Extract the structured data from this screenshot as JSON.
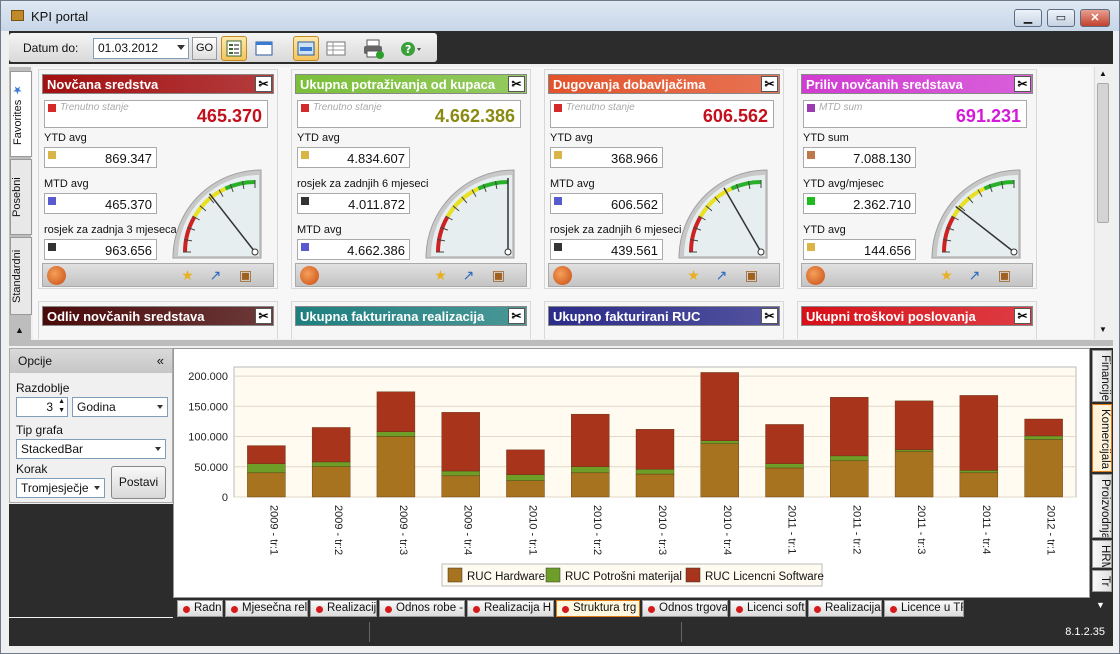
{
  "window": {
    "title": "KPI portal",
    "controls": [
      "minimize",
      "maximize",
      "close"
    ]
  },
  "toolbar": {
    "date_label": "Datum do:",
    "date_value": "01.03.2012",
    "go_label": "GO"
  },
  "side_tabs": [
    "Favorites",
    "Posebni",
    "Standardni"
  ],
  "cards_row1": [
    {
      "title": "Novčana sredstva",
      "head_color": "#a30f10",
      "main_square_color": "#d42a2a",
      "main_label": "Trenutno stanje",
      "main_value": "465.370",
      "main_value_color": "#c4101c",
      "rows": [
        {
          "label": "YTD avg",
          "value": "869.347",
          "color": "#d9b548"
        },
        {
          "label": "MTD avg",
          "value": "465.370",
          "color": "#5a5ad0"
        },
        {
          "label": "rosjek za zadnja 3 mjeseca",
          "value": "963.656",
          "color": "#333333"
        }
      ],
      "needle_angle": -38
    },
    {
      "title": "Ukupna potraživanja od kupaca",
      "head_color": "#7bbf3a",
      "main_square_color": "#d42a2a",
      "main_label": "Trenutno stanje",
      "main_value": "4.662.386",
      "main_value_color": "#8a8a10",
      "rows": [
        {
          "label": "YTD avg",
          "value": "4.834.607",
          "color": "#d9b548"
        },
        {
          "label": "rosjek za zadnjih 6 mjeseci",
          "value": "4.011.872",
          "color": "#333333"
        },
        {
          "label": "MTD avg",
          "value": "4.662.386",
          "color": "#5a5ad0"
        }
      ],
      "needle_angle": 0
    },
    {
      "title": "Dugovanja dobavljačima",
      "head_color": "#e3532b",
      "main_square_color": "#d42a2a",
      "main_label": "Trenutno stanje",
      "main_value": "606.562",
      "main_value_color": "#c4101c",
      "rows": [
        {
          "label": "YTD avg",
          "value": "368.966",
          "color": "#d9b548"
        },
        {
          "label": "MTD avg",
          "value": "606.562",
          "color": "#5a5ad0"
        },
        {
          "label": "rosjek za zadnjih 6 mjeseci",
          "value": "439.561",
          "color": "#333333"
        }
      ],
      "needle_angle": -30
    },
    {
      "title": "Priliv novčanih sredstava",
      "head_color": "#d13bd3",
      "main_square_color": "#9b3bb0",
      "main_label": "MTD sum",
      "main_value": "691.231",
      "main_value_color": "#d41ad8",
      "rows": [
        {
          "label": "YTD sum",
          "value": "7.088.130",
          "color": "#c0784a"
        },
        {
          "label": "YTD avg/mjesec",
          "value": "2.362.710",
          "color": "#1fba1f"
        },
        {
          "label": "YTD avg",
          "value": "144.656",
          "color": "#d9b548"
        }
      ],
      "needle_angle": -52
    }
  ],
  "cards_row2": [
    {
      "title": "Odliv novčanih sredstava",
      "head_color": "#4a0a0a"
    },
    {
      "title": "Ukupna fakturirana realizacija",
      "head_color": "#1e7f7f"
    },
    {
      "title": "Ukupno fakturirani RUC",
      "head_color": "#2b2b8a"
    },
    {
      "title": "Ukupni troškovi poslovanja",
      "head_color": "#d80f18"
    }
  ],
  "options": {
    "header": "Opcije",
    "razdoblje_label": "Razdoblje",
    "razdoblje_value": "3",
    "period_unit": "Godina",
    "tip_label": "Tip grafa",
    "tip_value": "StackedBar",
    "korak_label": "Korak",
    "korak_value": "Tromjesječje",
    "apply_label": "Postavi"
  },
  "chart_data": {
    "type": "bar",
    "stacked": true,
    "categories": [
      "2009 - tr:1",
      "2009 - tr:2",
      "2009 - tr:3",
      "2009 - tr:4",
      "2010 - tr:1",
      "2010 - tr:2",
      "2010 - tr:3",
      "2010 - tr:4",
      "2011 - tr:1",
      "2011 - tr:2",
      "2011 - tr:3",
      "2011 - tr:4",
      "2012 - tr:1"
    ],
    "series": [
      {
        "name": "RUC Hardware",
        "color": "#a8731e",
        "values": [
          40000,
          50000,
          100000,
          35000,
          27000,
          40000,
          38000,
          88000,
          48000,
          60000,
          75000,
          40000,
          95000
        ]
      },
      {
        "name": "RUC Potrošni materijal",
        "color": "#6e9e28",
        "values": [
          15000,
          8000,
          8000,
          8000,
          10000,
          10000,
          8000,
          5000,
          7000,
          8000,
          3000,
          4000,
          6000
        ]
      },
      {
        "name": "RUC Licencni Software",
        "color": "#a8341c",
        "values": [
          30000,
          57000,
          66000,
          97000,
          41000,
          87000,
          66000,
          113000,
          65000,
          97000,
          81000,
          124000,
          28000
        ]
      }
    ],
    "ylim": [
      0,
      215000
    ],
    "yticks": [
      "0",
      "50.000",
      "100.000",
      "150.000",
      "200.000"
    ],
    "ytick_values": [
      0,
      50000,
      100000,
      150000,
      200000
    ],
    "legend_position": "bottom-center",
    "grid": true
  },
  "bottom_tabs": [
    "Radni",
    "Mjesečna reli",
    "Realizacija",
    "Odnos robe -",
    "Realizacija H",
    "Struktura trg",
    "Odnos trgovač",
    "Licenci soft",
    "Realizacija",
    "Licence u TR"
  ],
  "bottom_tab_active": 5,
  "right_tabs": [
    "Financije",
    "Komercijala",
    "Proizvodnja",
    "HRM",
    "Tr"
  ],
  "right_tab_active": 1,
  "status": {
    "version": "8.1.2.35"
  }
}
